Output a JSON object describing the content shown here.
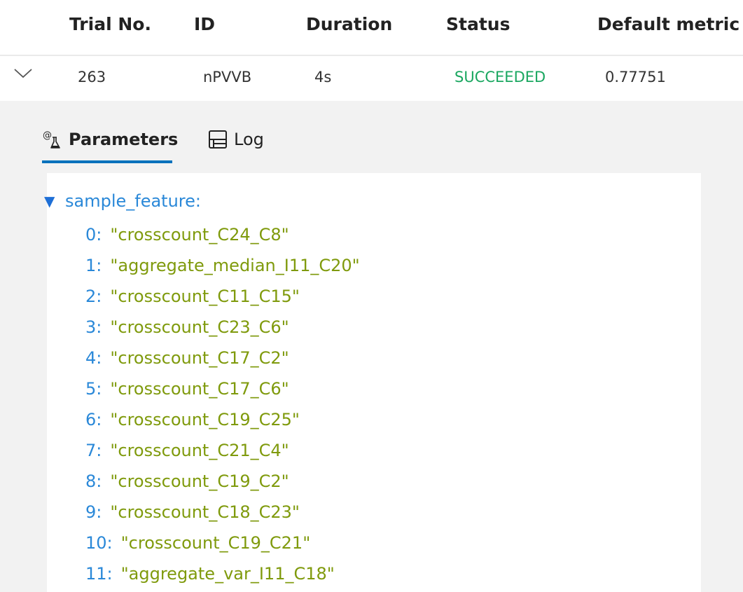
{
  "table": {
    "columns": [
      "Trial No.",
      "ID",
      "Duration",
      "Status",
      "Default metric"
    ]
  },
  "trial": {
    "expand_icon": "chevron-down-icon",
    "trial_no": "263",
    "id": "nPVVB",
    "duration": "4s",
    "status": "SUCCEEDED",
    "default_metric": "0.77751"
  },
  "colors": {
    "status_success": "#1aa760",
    "tab_active_underline": "#0071bc",
    "json_key": "#2a88d8",
    "json_string": "#7f9a0c",
    "panel_background": "#f2f2f2"
  },
  "detail": {
    "tabs": [
      {
        "label": "Parameters",
        "icon": "parameters-icon",
        "active": true
      },
      {
        "label": "Log",
        "icon": "log-icon",
        "active": false
      }
    ],
    "parameters": {
      "key": "sample_feature:",
      "items": [
        {
          "index": "0:",
          "value": "\"crosscount_C24_C8\""
        },
        {
          "index": "1:",
          "value": "\"aggregate_median_I11_C20\""
        },
        {
          "index": "2:",
          "value": "\"crosscount_C11_C15\""
        },
        {
          "index": "3:",
          "value": "\"crosscount_C23_C6\""
        },
        {
          "index": "4:",
          "value": "\"crosscount_C17_C2\""
        },
        {
          "index": "5:",
          "value": "\"crosscount_C17_C6\""
        },
        {
          "index": "6:",
          "value": "\"crosscount_C19_C25\""
        },
        {
          "index": "7:",
          "value": "\"crosscount_C21_C4\""
        },
        {
          "index": "8:",
          "value": "\"crosscount_C19_C2\""
        },
        {
          "index": "9:",
          "value": "\"crosscount_C18_C23\""
        },
        {
          "index": "10:",
          "value": "\"crosscount_C19_C21\""
        },
        {
          "index": "11:",
          "value": "\"aggregate_var_I11_C18\""
        }
      ]
    }
  }
}
